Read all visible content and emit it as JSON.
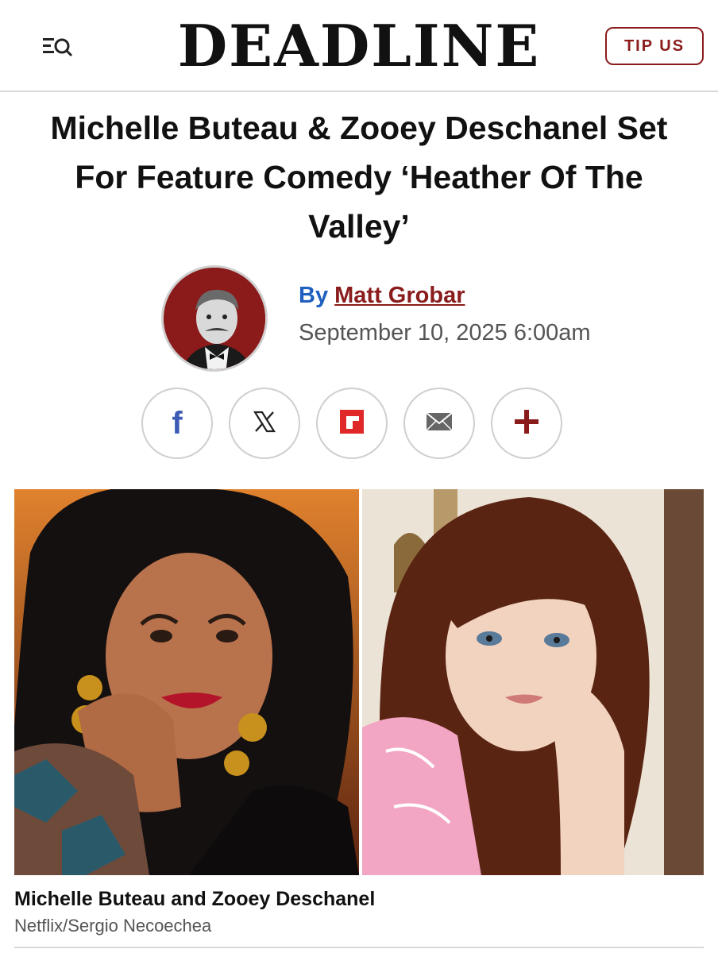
{
  "header": {
    "logo": "DEADLINE",
    "tip_label": "TIP US",
    "menu_icon": "menu-search-icon"
  },
  "article": {
    "headline": "Michelle Buteau & Zooey Deschanel Set For Feature Comedy ‘Heather Of The Valley’",
    "byline_prefix": "By",
    "author": "Matt Grobar",
    "date": "September 10, 2025 6:00am"
  },
  "share": {
    "facebook_glyph": "f",
    "x_glyph": "𝕏",
    "icons": [
      "facebook-icon",
      "x-icon",
      "flipboard-icon",
      "email-icon",
      "plus-icon"
    ]
  },
  "photo": {
    "caption": "Michelle Buteau and Zooey Deschanel",
    "credit": "Netflix/Sergio Necoechea"
  },
  "colors": {
    "brand_red": "#8a1c1c",
    "link_blue": "#1f5fbf",
    "facebook_blue": "#3b5bb5",
    "flipboard_red": "#e12828"
  }
}
